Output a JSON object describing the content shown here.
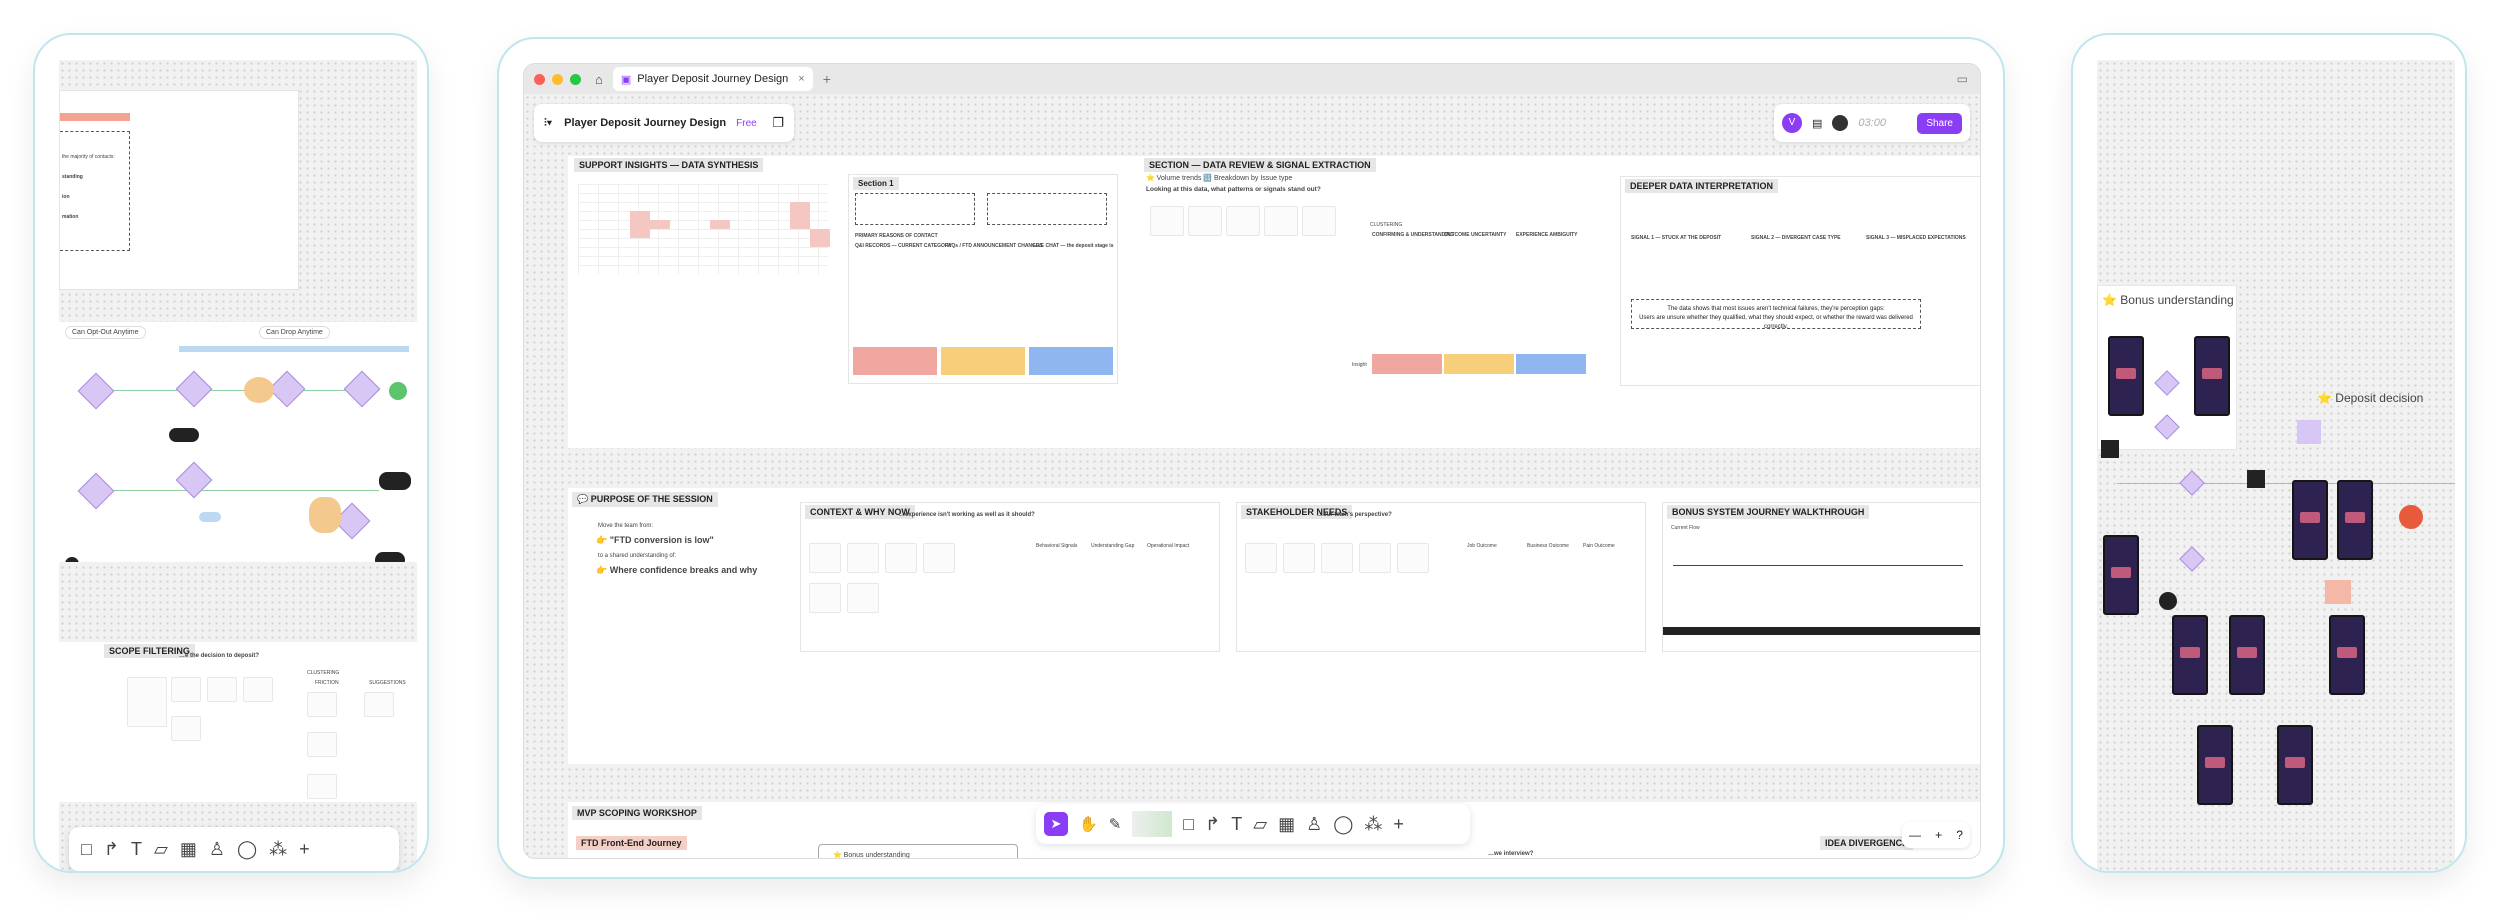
{
  "app": {
    "tab_title": "Player Deposit Journey Design",
    "doc_title": "Player Deposit Journey Design",
    "plan_badge": "Free",
    "share_label": "Share",
    "avatar_initial": "V",
    "timer": "03:00",
    "accent": "#8b3df5"
  },
  "colors": {
    "accent": "#8b3df5",
    "red": "#f0a7a0",
    "yellow": "#f7cf7a",
    "blue": "#8fb6ef",
    "green": "#5cc46a",
    "purple": "#d8c6f5"
  },
  "icons": [
    "home-icon",
    "board-icon",
    "close-icon",
    "plus-icon",
    "menu-icon",
    "copy-icon",
    "layout-icon",
    "cursor-icon",
    "hand-icon",
    "pen-icon",
    "square-icon",
    "connector-icon",
    "text-icon",
    "sticky-icon",
    "table-icon",
    "person-icon",
    "comment-icon",
    "apps-icon",
    "zoom-out-icon",
    "zoom-in-icon",
    "help-icon"
  ],
  "zoom": {
    "minus": "—",
    "plus": "+",
    "help": "?"
  },
  "sections": {
    "support": {
      "title": "SUPPORT INSIGHTS — DATA SYNTHESIS",
      "sub": "Section 1",
      "primary": "PRIMARY REASONS OF CONTACT",
      "c1": "Q&I RECORDS — CURRENT CATEGORY",
      "c2": "FAQs / FTD ANNOUNCEMENT CHANGES",
      "c3": "LIVE CHAT — the deposit stage is"
    },
    "review": {
      "title": "SECTION — DATA REVIEW & SIGNAL EXTRACTION",
      "vol": "⭐ Volume trends 🔢 Breakdown by Issue type",
      "q": "Looking at this data, what patterns or signals stand out?",
      "clustering": "CLUSTERING",
      "n1": "CONFIRMING & UNDERSTANDING",
      "n2": "OUTCOME UNCERTAINTY",
      "n3": "EXPERIENCE AMBIGUITY",
      "impact": "Insight"
    },
    "deeper": {
      "title": "DEEPER DATA INTERPRETATION",
      "s1": "SIGNAL 1 — STUCK AT THE DEPOSIT",
      "s2": "SIGNAL 2 — DIVERGENT CASE TYPE",
      "s3": "SIGNAL 3 — MISPLACED EXPECTATIONS",
      "box1": "The data shows that most issues aren't technical failures, they're perception gaps:",
      "box2": "Users are unsure whether they qualified, what they should expect, or whether the reward was delivered correctly."
    },
    "purpose": {
      "title": "💬 PURPOSE OF THE SESSION",
      "move": "Move the team from:",
      "ftd": "👉 \"FTD conversion is low\"",
      "shared": "to a shared understanding of:",
      "where": "👉 Where confidence breaks and why"
    },
    "context": {
      "title": "CONTEXT & WHY NOW",
      "q": "…experience isn't working as well as it should?",
      "a": "Behavioral Signals",
      "b": "Understanding Gap",
      "c": "Operational Impact"
    },
    "stake": {
      "title": "STAKEHOLDER NEEDS",
      "q": "…our team's perspective?",
      "a": "Job Outcome",
      "b": "Business Outcome",
      "c": "Pain Outcome"
    },
    "bonus": {
      "title": "BONUS SYSTEM JOURNEY WALKTHROUGH",
      "cur": "Current Flow"
    },
    "mvp": {
      "title": "MVP SCOPING WORKSHOP"
    },
    "ftd": {
      "title": "FTD Front-End Journey",
      "bonus": "⭐ Bonus understanding"
    },
    "idea": {
      "title": "IDEA DIVERGENCE",
      "q": "…we interview?"
    }
  },
  "left": {
    "contacts": "the majority of contacts:",
    "standing": "standing",
    "ion": "ion",
    "mation": "mation",
    "optout": "Can Opt-Out Anytime",
    "drop": "Can Drop Anytime",
    "scope": "SCOPE FILTERING",
    "scope_q": "…e the decision to deposit?",
    "clustering": "CLUSTERING",
    "friction": "FRICTION",
    "frt": "FRT",
    "suggestions": "SUGGESTIONS"
  },
  "right": {
    "bonus": "⭐ Bonus understanding",
    "deposit": "⭐ Deposit decision"
  }
}
